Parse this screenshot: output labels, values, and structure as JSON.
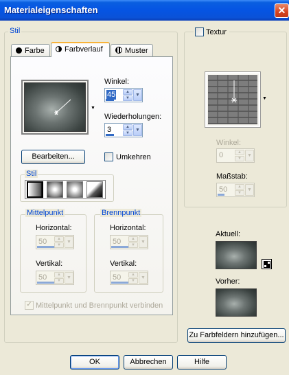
{
  "window": {
    "title": "Materialeigenschaften",
    "close_glyph": "✕"
  },
  "stil": {
    "group_label": "Stil",
    "tabs": [
      {
        "label": "Farbe",
        "icon": "color-dot-icon"
      },
      {
        "label": "Farbverlauf",
        "icon": "gradient-icon",
        "active": true
      },
      {
        "label": "Muster",
        "icon": "pattern-icon"
      }
    ],
    "winkel_label": "Winkel:",
    "winkel_value": "45",
    "wiederholungen_label": "Wiederholungen:",
    "wiederholungen_value": "3",
    "bearbeiten_label": "Bearbeiten...",
    "umkehren_label": "Umkehren",
    "umkehren_checked": false,
    "stil_group_label": "Stil",
    "stil_options": [
      "linear",
      "rectangular",
      "sunburst",
      "radial"
    ],
    "mittelpunkt": {
      "label": "Mittelpunkt",
      "horizontal_label": "Horizontal:",
      "horizontal_value": "50",
      "vertikal_label": "Vertikal:",
      "vertikal_value": "50"
    },
    "brennpunkt": {
      "label": "Brennpunkt",
      "horizontal_label": "Horizontal:",
      "horizontal_value": "50",
      "vertikal_label": "Vertikal:",
      "vertikal_value": "50"
    },
    "verbinden_label": "Mittelpunkt und Brennpunkt verbinden",
    "verbinden_checked": true
  },
  "textur": {
    "label": "Textur",
    "checked": false,
    "winkel_label": "Winkel:",
    "winkel_value": "0",
    "massstab_label": "Maßstab:",
    "massstab_value": "50"
  },
  "preview": {
    "aktuell_label": "Aktuell:",
    "vorher_label": "Vorher:",
    "add_button_label": "Zu Farbfeldern hinzufügen..."
  },
  "footer": {
    "ok_label": "OK",
    "cancel_label": "Abbrechen",
    "help_label": "Hilfe"
  }
}
